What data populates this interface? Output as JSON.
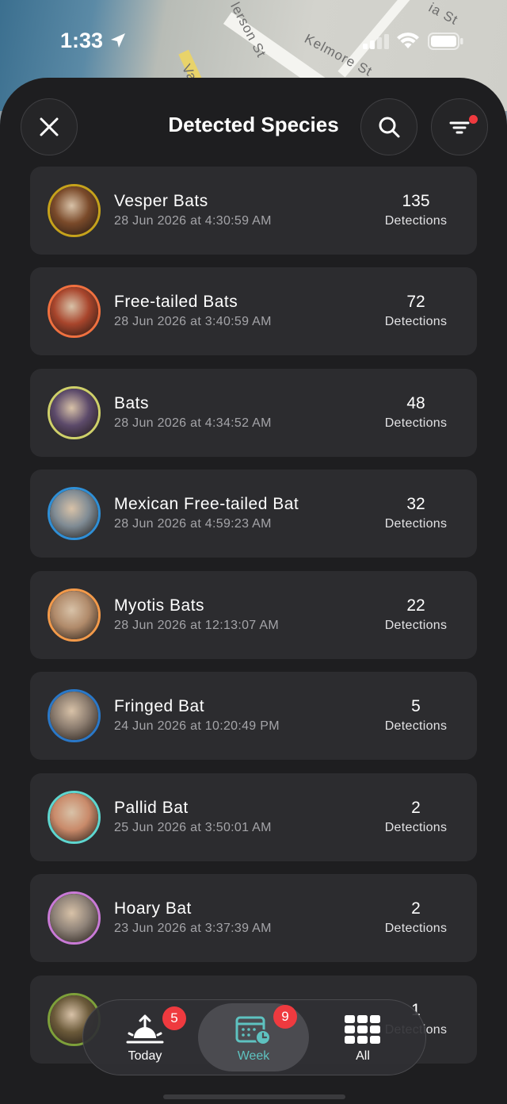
{
  "status_bar": {
    "time": "1:33"
  },
  "map": {
    "streets": [
      "lerson St",
      "Kelmore St",
      "Va",
      "ia St"
    ]
  },
  "header": {
    "title": "Detected Species",
    "close_icon": "close-icon",
    "search_icon": "search-icon",
    "filter_icon": "filter-icon",
    "filter_active_dot_color": "#ef3a3f"
  },
  "species": [
    {
      "name": "Vesper Bats",
      "date": "28 Jun 2026 at 4:30:59 AM",
      "count": "135",
      "unit": "Detections",
      "ring": "#c6a21b",
      "fill": "#7a4a2a"
    },
    {
      "name": "Free-tailed Bats",
      "date": "28 Jun 2026 at 3:40:59 AM",
      "count": "72",
      "unit": "Detections",
      "ring": "#f0703f",
      "fill": "#a8452c"
    },
    {
      "name": "Bats",
      "date": "28 Jun 2026 at 4:34:52 AM",
      "count": "48",
      "unit": "Detections",
      "ring": "#cfd06a",
      "fill": "#5c4a6a"
    },
    {
      "name": "Mexican Free-tailed Bat",
      "date": "28 Jun 2026 at 4:59:23 AM",
      "count": "32",
      "unit": "Detections",
      "ring": "#2f8fd6",
      "fill": "#7f8b94"
    },
    {
      "name": "Myotis Bats",
      "date": "28 Jun 2026 at 12:13:07 AM",
      "count": "22",
      "unit": "Detections",
      "ring": "#f39a4a",
      "fill": "#b08a6a"
    },
    {
      "name": "Fringed Bat",
      "date": "24 Jun 2026 at 10:20:49 PM",
      "count": "5",
      "unit": "Detections",
      "ring": "#2a78c8",
      "fill": "#8a7b6e"
    },
    {
      "name": "Pallid Bat",
      "date": "25 Jun 2026 at 3:50:01 AM",
      "count": "2",
      "unit": "Detections",
      "ring": "#5ed6cf",
      "fill": "#c98a6a"
    },
    {
      "name": "Hoary Bat",
      "date": "23 Jun 2026 at 3:37:39 AM",
      "count": "2",
      "unit": "Detections",
      "ring": "#c97ad6",
      "fill": "#8e8278"
    },
    {
      "name": "",
      "date": "",
      "count": "1",
      "unit": "Detections",
      "ring": "#7ea03a",
      "fill": "#6b5a3a"
    }
  ],
  "tabs": [
    {
      "label": "Today",
      "badge": "5",
      "icon": "sunrise-icon",
      "active": false
    },
    {
      "label": "Week",
      "badge": "9",
      "icon": "calendar-clock-icon",
      "active": true
    },
    {
      "label": "All",
      "badge": "",
      "icon": "grid-icon",
      "active": false
    }
  ],
  "colors": {
    "accent_teal": "#5ec2c0",
    "badge_red": "#ef3a3f",
    "card_bg": "#2c2c2f",
    "sheet_bg": "#1e1e20"
  }
}
